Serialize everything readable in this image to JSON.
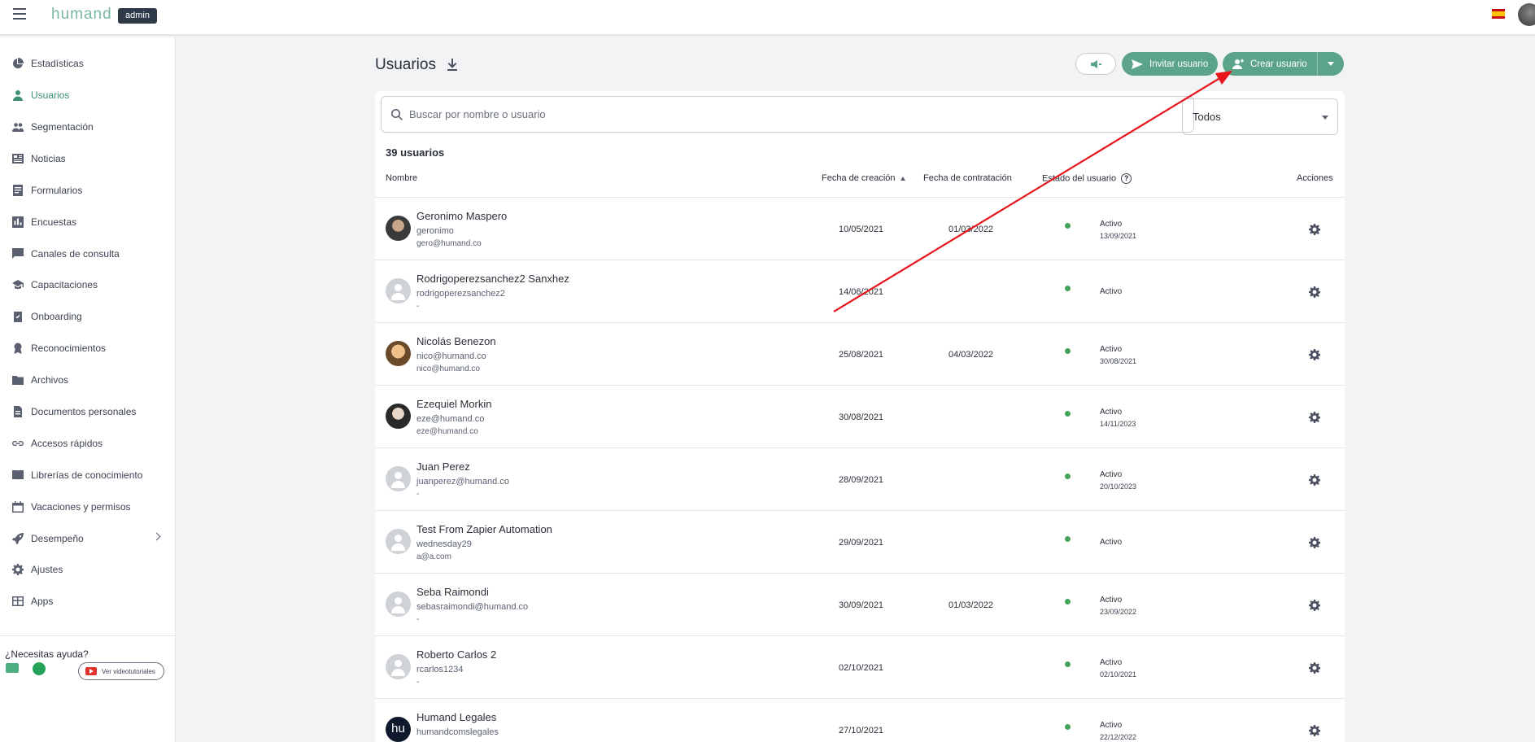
{
  "topbar": {
    "logo": "humand",
    "badge": "admin"
  },
  "sidebar": {
    "items": [
      {
        "label": "Estadísticas",
        "icon": "pie-chart-icon"
      },
      {
        "label": "Usuarios",
        "icon": "person-icon",
        "active": true
      },
      {
        "label": "Segmentación",
        "icon": "group-icon"
      },
      {
        "label": "Noticias",
        "icon": "newspaper-icon"
      },
      {
        "label": "Formularios",
        "icon": "form-icon"
      },
      {
        "label": "Encuestas",
        "icon": "bar-chart-icon"
      },
      {
        "label": "Canales de consulta",
        "icon": "chat-icon"
      },
      {
        "label": "Capacitaciones",
        "icon": "graduation-cap-icon"
      },
      {
        "label": "Onboarding",
        "icon": "clipboard-icon"
      },
      {
        "label": "Reconocimientos",
        "icon": "medal-icon"
      },
      {
        "label": "Archivos",
        "icon": "folder-icon"
      },
      {
        "label": "Documentos personales",
        "icon": "document-icon"
      },
      {
        "label": "Accesos rápidos",
        "icon": "link-icon"
      },
      {
        "label": "Librerías de conocimiento",
        "icon": "book-icon"
      },
      {
        "label": "Vacaciones y permisos",
        "icon": "calendar-icon"
      },
      {
        "label": "Desempeño",
        "icon": "rocket-icon",
        "has_submenu": true
      },
      {
        "label": "Ajustes",
        "icon": "gear-icon"
      },
      {
        "label": "Apps",
        "icon": "apps-icon"
      }
    ],
    "help_title": "¿Necesitas ayuda?",
    "video_button": "Ver videotutoriales"
  },
  "header": {
    "title": "Usuarios",
    "invite_label": "Invitar usuario",
    "create_label": "Crear usuario"
  },
  "search": {
    "placeholder": "Buscar por nombre o usuario"
  },
  "filter": {
    "value": "Todos"
  },
  "count_label": "39 usuarios",
  "columns": {
    "name": "Nombre",
    "created": "Fecha de creación",
    "hired": "Fecha de contratación",
    "status": "Estado del usuario",
    "actions": "Acciones"
  },
  "users": [
    {
      "name": "Geronimo Maspero",
      "username": "geronimo",
      "email": "gero@humand.co",
      "created": "10/05/2021",
      "hired": "01/03/2022",
      "status": "Activo",
      "status_date": "13/09/2021"
    },
    {
      "name": "Rodrigoperezsanchez2 Sanxhez",
      "username": "rodrigoperezsanchez2",
      "email": "-",
      "created": "14/06/2021",
      "hired": "",
      "status": "Activo",
      "status_date": ""
    },
    {
      "name": "Nicolás Benezon",
      "username": "nico@humand.co",
      "email": "nico@humand.co",
      "created": "25/08/2021",
      "hired": "04/03/2022",
      "status": "Activo",
      "status_date": "30/08/2021"
    },
    {
      "name": "Ezequiel Morkin",
      "username": "eze@humand.co",
      "email": "eze@humand.co",
      "created": "30/08/2021",
      "hired": "",
      "status": "Activo",
      "status_date": "14/11/2023"
    },
    {
      "name": "Juan Perez",
      "username": "juanperez@humand.co",
      "email": "-",
      "created": "28/09/2021",
      "hired": "",
      "status": "Activo",
      "status_date": "20/10/2023"
    },
    {
      "name": "Test From Zapier Automation",
      "username": "wednesday29",
      "email": "a@a.com",
      "created": "29/09/2021",
      "hired": "",
      "status": "Activo",
      "status_date": ""
    },
    {
      "name": "Seba Raimondi",
      "username": "sebasraimondi@humand.co",
      "email": "-",
      "created": "30/09/2021",
      "hired": "01/03/2022",
      "status": "Activo",
      "status_date": "23/09/2022"
    },
    {
      "name": "Roberto Carlos 2",
      "username": "rcarlos1234",
      "email": "-",
      "created": "02/10/2021",
      "hired": "",
      "status": "Activo",
      "status_date": "02/10/2021"
    },
    {
      "name": "Humand Legales",
      "username": "humandcomslegales",
      "email": "",
      "created": "27/10/2021",
      "hired": "",
      "status": "Activo",
      "status_date": "22/12/2022",
      "avatar_text": "hu"
    }
  ],
  "colors": {
    "accent": "#5ba489",
    "active_nav": "#3d8f75",
    "status_dot": "#43a35a",
    "annotation_arrow": "#e8141b"
  }
}
